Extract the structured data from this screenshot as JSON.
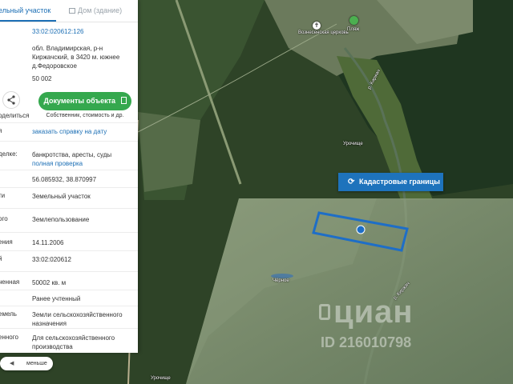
{
  "tabs": {
    "land": "ельный участок",
    "house": "Дом (здание)"
  },
  "card": {
    "cadastral_number": "33:02:020612:126",
    "address": "обл. Владимирская, р-н Киржачский, в 3420 м. южнее д.Федоровское",
    "area_number": "50 002",
    "share_label": "оделиться",
    "documents_button": "Документы объекта",
    "documents_sub": "Собственник, стоимость и др.",
    "info_label": "я",
    "info_link": "заказать справку на дату",
    "deals_label": "делке:",
    "deals_text": "банкротства, аресты, суды",
    "deals_link": "полная проверка",
    "coords_label": ":",
    "coords": "56.085932, 38.870997",
    "rows": [
      {
        "label": "ти",
        "value": "Земельный участок"
      },
      {
        "label": "ого",
        "value": "Землепользование"
      },
      {
        "label": "ения",
        "value": "14.11.2006"
      },
      {
        "label": "й",
        "value": "33:02:020612"
      },
      {
        "label": "ченная",
        "value": "50002 кв. м"
      },
      {
        "label": "",
        "value": "Ранее учтенный"
      },
      {
        "label": "емель",
        "value": "Земли сельскохозяйственного назначения"
      },
      {
        "label": "енного",
        "value": "Для сельскохозяйственного производства"
      }
    ]
  },
  "less_button": "меньше",
  "cadastral_button": "Кадастровые границы",
  "map_labels": {
    "church": "Вознесенская церковь",
    "beach": "Пляж",
    "river_top": "р. Киржач",
    "river_bottom": "р. Киржач",
    "forest": "Урочище",
    "lake": "Чёрное",
    "bottom": "Урочище"
  },
  "watermark": {
    "brand": "циан",
    "id": "ID 216010798"
  },
  "icons": {
    "share": "share-icon",
    "doc": "document-icon",
    "refresh": "refresh-icon",
    "arrow": "arrow-left-icon",
    "church": "church-icon",
    "beach": "beach-icon",
    "marker": "location-marker-icon"
  }
}
